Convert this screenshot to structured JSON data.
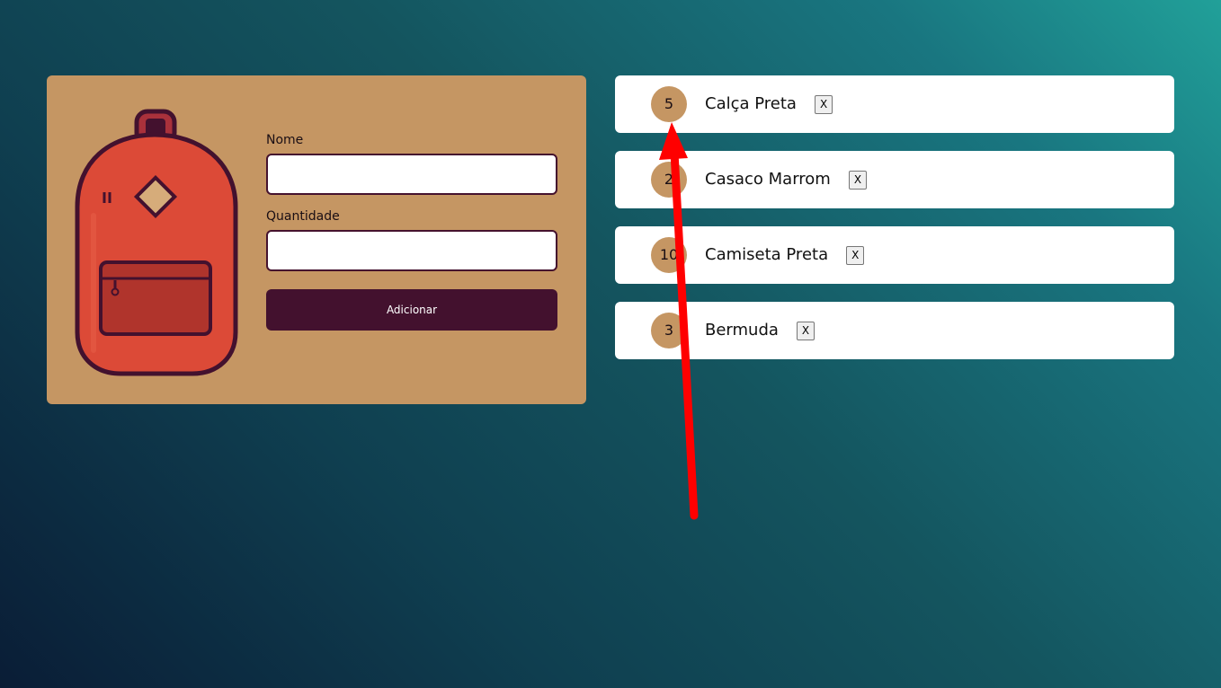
{
  "form": {
    "name_label": "Nome",
    "name_value": "",
    "quantity_label": "Quantidade",
    "quantity_value": "",
    "submit_label": "Adicionar"
  },
  "items": [
    {
      "quantity": "5",
      "name": "Calça Preta",
      "remove_label": "X"
    },
    {
      "quantity": "2",
      "name": "Casaco Marrom",
      "remove_label": "X"
    },
    {
      "quantity": "10",
      "name": "Camiseta Preta",
      "remove_label": "X"
    },
    {
      "quantity": "3",
      "name": "Bermuda",
      "remove_label": "X"
    }
  ],
  "icons": {
    "illustration": "backpack-icon",
    "annotation": "red-arrow-icon"
  },
  "colors": {
    "card_background": "#c59663",
    "accent_dark": "#43112e",
    "backpack_red": "#dc4a37",
    "annotation_arrow": "#ff0000"
  }
}
